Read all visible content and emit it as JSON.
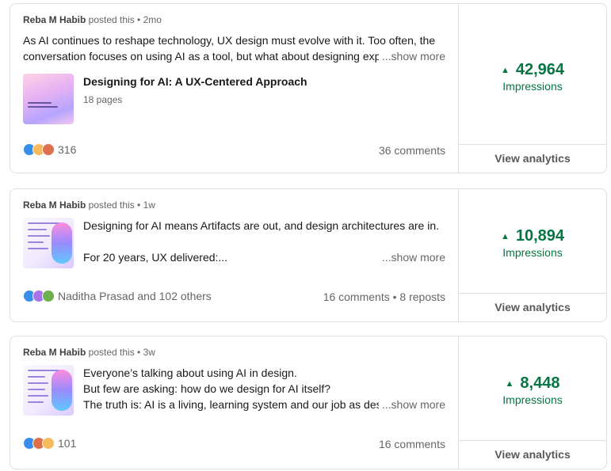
{
  "posts": [
    {
      "author": "Reba M Habib",
      "posted": " posted this • 2mo",
      "text_line1": "As AI continues to reshape technology, UX design must evolve with it. Too often, the",
      "text_line2": "conversation focuses on using AI as a tool, but what about designing exp",
      "see_more": "...show more",
      "document_title": "Designing for AI: A UX-Centered Approach",
      "document_pages": "18 pages",
      "reactions_count": "316",
      "comments": "36 comments",
      "impressions_value": "42,964",
      "impressions_label": "Impressions",
      "analytics_link": "View analytics"
    },
    {
      "author": "Reba M Habib",
      "posted": " posted this • 1w",
      "text_line1": "Designing for AI means Artifacts are out, and design architectures are in.",
      "text_line2": "",
      "text_line3": "For 20 years, UX delivered:...",
      "see_more": "...show more",
      "reactions_count": "Naditha Prasad and 102 others",
      "comments": "16 comments • 8 reposts",
      "impressions_value": "10,894",
      "impressions_label": "Impressions",
      "analytics_link": "View analytics"
    },
    {
      "author": "Reba M Habib",
      "posted": " posted this • 3w",
      "text_line1": "Everyone’s talking about using AI in design.",
      "text_line2": "But few are asking: how do we design for AI itself?",
      "text_line3": "The truth is: AI is a living, learning system and our job as des",
      "see_more": "...show more",
      "reactions_count": "101",
      "comments": "16 comments",
      "impressions_value": "8,448",
      "impressions_label": "Impressions",
      "analytics_link": "View analytics"
    }
  ]
}
